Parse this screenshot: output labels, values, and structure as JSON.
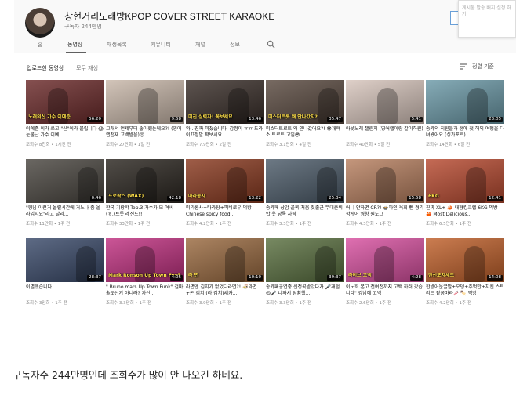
{
  "channel": {
    "name": "창현거리노래방KPOP COVER STREET KARAOKE",
    "subscribers": "구독자 244만명",
    "popup_text": "게시물 발송 배지 설정 하기"
  },
  "tabs": [
    {
      "label": "홈"
    },
    {
      "label": "동영상"
    },
    {
      "label": "재생목록"
    },
    {
      "label": "커뮤니티"
    },
    {
      "label": "채널"
    },
    {
      "label": "정보"
    }
  ],
  "section": {
    "title": "업로드한 동영상",
    "play_all": "모두 재생",
    "sort_label": "정렬 기준"
  },
  "videos": [
    {
      "title": "이예준 이라 쓰고 \"신\"이라 불립니다 😱눈물난 가수 이예...",
      "meta": "조회수 8천회 • 1시간 전",
      "duration": "56:20",
      "caption": "노래의신 가수 이예준",
      "bg": "#6b2a2a"
    },
    {
      "title": "그래서 언제부터 좋아했는데요?! (영어랩천재 고백받음)😍",
      "meta": "조회수 27만회 • 1일 전",
      "duration": "9:58",
      "caption": "",
      "bg": "#c9b8aa"
    },
    {
      "title": "와.. 진짜 미쳤습니다. 감정이 ㅠㅠ 도라이끄정말 꽉보시요",
      "meta": "조회수 7.9만회 • 2일 전",
      "duration": "13:46",
      "caption": "미친 실력자! 꼭보세요",
      "bg": "#3a2f2a"
    },
    {
      "title": "미스터트로트 왜 안나갔어요?! 😎개혁 소 트로트 고임😎",
      "meta": "조회수 3.1만회 • 4일 전",
      "duration": "35:47",
      "caption": "미스터트롯 왜 안나갔지?",
      "bg": "#5a4a40"
    },
    {
      "title": "아웃노래 챌린지 (영어랩이랑 같이하원)",
      "meta": "조회수 40만회 • 5일 전",
      "duration": "5:41",
      "caption": "",
      "bg": "#d8c6bd"
    },
    {
      "title": "송카의 직원들과 생애 첫 해외 여행을 다녀왔어요 (싱가포르)",
      "meta": "조회수 14만회 • 6일 전",
      "duration": "23:05",
      "caption": "",
      "bg": "#6c9aa8"
    },
    {
      "title": "\"형님 이런거 올릴시간에 거노나 좀 올라입시요\"라고 달리...",
      "meta": "조회수 11만회 • 1주 전",
      "duration": "0:46",
      "caption": "",
      "bg": "#4a4640"
    },
    {
      "title": "한국 기랑학 Top.3 가수가 모 여씨 (ㅎ.)트롯 레전드!!",
      "meta": "조회수 33만회 • 1주 전",
      "duration": "42:18",
      "caption": "프로왁스 (WAX)",
      "bg": "#2b2620"
    },
    {
      "title": "미리롱사+타라탕+퍼비로우 먹방 Chinese spicy food...",
      "meta": "조회수 4.2만회 • 1주 전",
      "duration": "13:22",
      "caption": "마라롱샤",
      "bg": "#8a3a20"
    },
    {
      "title": "송카페 상암 골목 처음 첫출근 무대준비 밥 옷 당록 사람",
      "meta": "조회수 3.3만회 • 1주 전",
      "duration": "25:34",
      "caption": "",
      "bg": "#4d5c6a"
    },
    {
      "title": "어니 안하면 CR?! 🍲파인 육회 뻰 경기깍게어 영향 원도그",
      "meta": "조회수 4.3만회 • 1주 전",
      "duration": "15:58",
      "caption": "",
      "bg": "#b88060"
    },
    {
      "title": "진짜 XL+ 🦀 대형킹크랩 6KG 먹방 🦀 Most Delicious...",
      "meta": "조회수 6.5만회 • 1주 전",
      "duration": "12:41",
      "caption": "6KG",
      "bg": "#b84a30"
    },
    {
      "title": "이별했습니다..",
      "meta": "조회수 3만회 • 1주 전",
      "duration": "28:37",
      "caption": "",
      "bg": "#3a4a6a"
    },
    {
      "title": "\" Bruno mars Up Town Funk\" 걸마 술도산거 아니라? 가신...",
      "meta": "조회수 3.3만회 • 1주 전",
      "duration": "4:05",
      "caption": "Mark Ronson Up Town Funk",
      "bg": "#c03080"
    },
    {
      "title": "라면엔 김치가 없었다라면?! 🍜라면+돈 김치 (라 김치)새카...",
      "meta": "조회수 3.9만회 • 1주 전",
      "duration": "10:10",
      "caption": "라 면",
      "bg": "#9a6a40"
    },
    {
      "title": "송카페공연중 신청곡받았다가 🎤개헐😍🎤 나와서 당황했...",
      "meta": "조회수 3.3만회 • 1주 전",
      "duration": "39:37",
      "caption": "",
      "bg": "#5a7040"
    },
    {
      "title": "이노희 본고 전여전까지 고백 하러 갔습니다\" 강남에 고백",
      "meta": "조회수 2.6만회 • 1주 전",
      "duration": "4:28",
      "caption": "라이브 고백",
      "bg": "#d850a0"
    },
    {
      "title": "한방어운끌발+오뎅+주먹밥+치킨 스트리트 팥꼼마라🥢 🍢 먹방",
      "meta": "조회수 4.2만회 • 1주 전",
      "duration": "14:08",
      "caption": "한신포차세트",
      "bg": "#c0602a"
    }
  ],
  "post_caption": "구독자수 244만명인데 조회수가 많이 안 나오긴 하네요."
}
